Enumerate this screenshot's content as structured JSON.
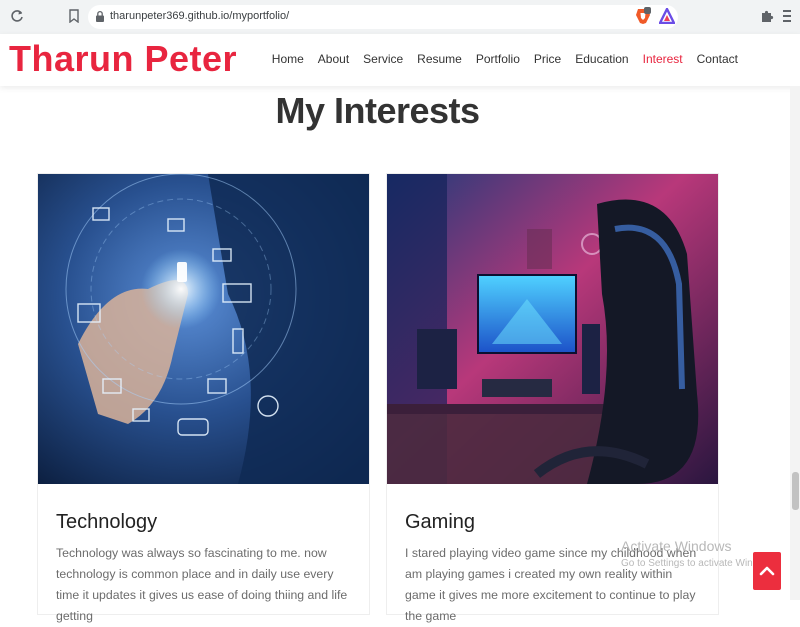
{
  "browser": {
    "url": "tharunpeter369.github.io/myportfolio/"
  },
  "header": {
    "brand": "Tharun Peter",
    "nav": [
      "Home",
      "About",
      "Service",
      "Resume",
      "Portfolio",
      "Price",
      "Education",
      "Interest",
      "Contact"
    ],
    "active_nav": "Interest"
  },
  "section": {
    "title": "My Interests"
  },
  "cards": [
    {
      "title": "Technology",
      "text": "Technology was always so fascinating to me. now technology is common place and in daily use every time it updates it gives us ease of doing thiing and life getting"
    },
    {
      "title": "Gaming",
      "text": "I stared playing video game since my childhood when am playing games i created my own reality within game it gives me more excitement to continue to play the game"
    }
  ],
  "watermark": {
    "line1": "Activate Windows",
    "line2": "Go to Settings to activate Windows."
  },
  "colors": {
    "brand": "#e8253f",
    "nav_text": "#333333",
    "scroll_button": "#ec2e3e"
  },
  "icons": [
    "reload-icon",
    "bookmark-icon",
    "lock-icon",
    "brave-icon",
    "triangle-icon",
    "puzzle-icon",
    "menu-icon",
    "chevron-up-icon"
  ]
}
